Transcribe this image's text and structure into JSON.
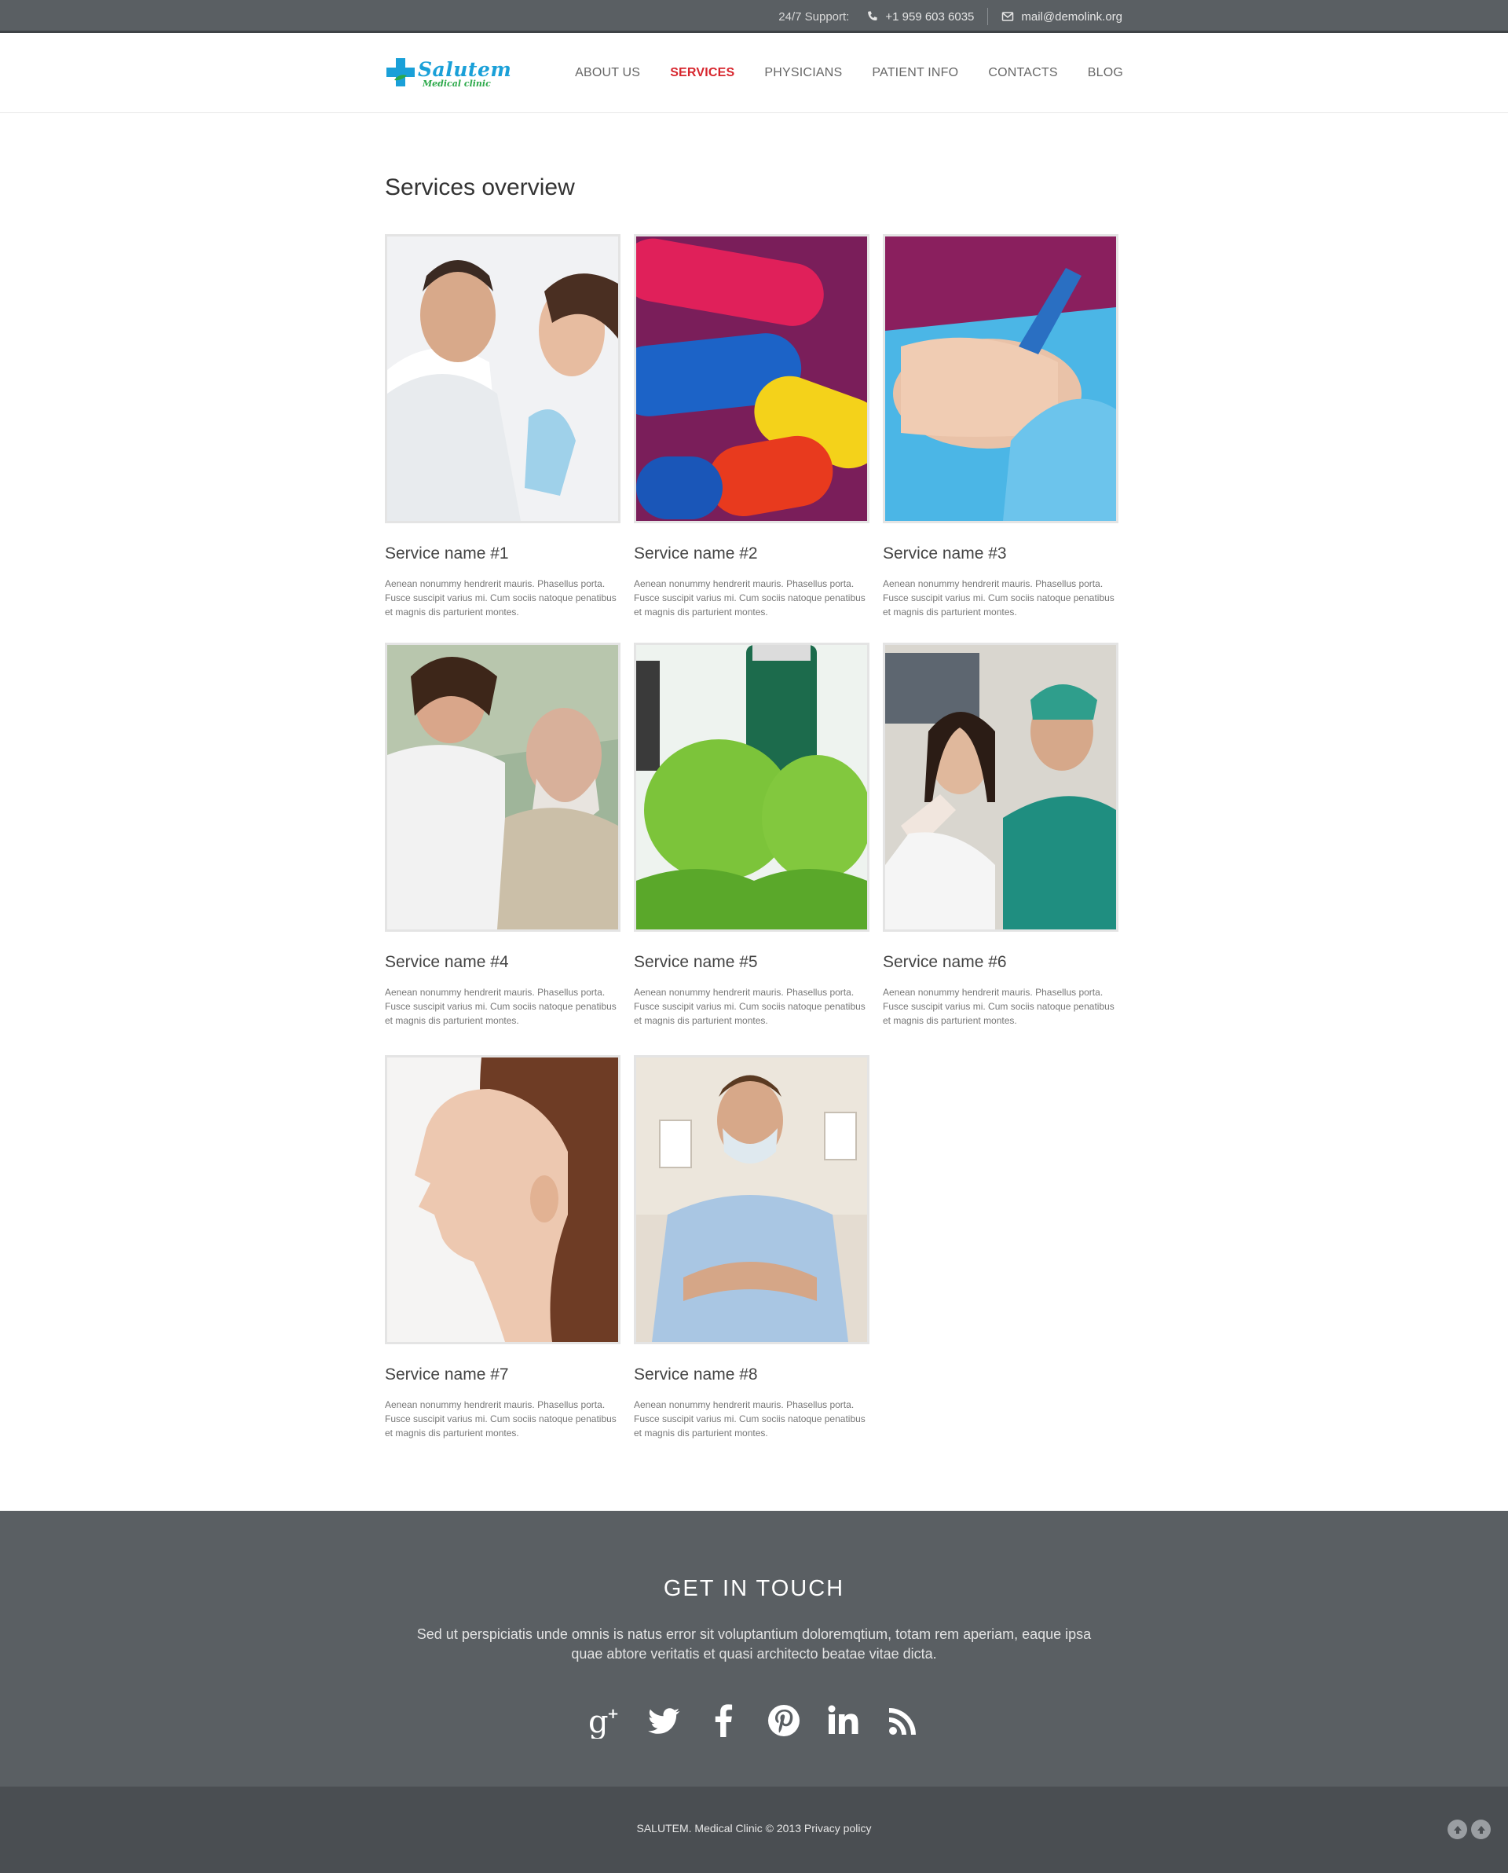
{
  "topbar": {
    "support_label": "24/7 Support:",
    "phone": "+1 959 603 6035",
    "email": "mail@demolink.org",
    "phone_icon": "phone-icon",
    "email_icon": "envelope-icon"
  },
  "logo": {
    "name": "Salutem",
    "tagline": "Medical clinic"
  },
  "nav": {
    "items": [
      {
        "label": "ABOUT US"
      },
      {
        "label": "SERVICES",
        "active": true
      },
      {
        "label": "PHYSICIANS"
      },
      {
        "label": "PATIENT INFO"
      },
      {
        "label": "CONTACTS"
      },
      {
        "label": "BLOG"
      }
    ]
  },
  "main": {
    "title": "Services overview",
    "services": [
      {
        "name": "Service name #1",
        "text": "Aenean nonummy hendrerit mauris. Phasellus porta. Fusce suscipit varius mi. Cum sociis natoque penatibus et magnis dis parturient montes."
      },
      {
        "name": "Service name #2",
        "text": "Aenean nonummy hendrerit mauris. Phasellus porta. Fusce suscipit varius mi. Cum sociis natoque penatibus et magnis dis parturient montes."
      },
      {
        "name": "Service name #3",
        "text": "Aenean nonummy hendrerit mauris. Phasellus porta. Fusce suscipit varius mi. Cum sociis natoque penatibus et magnis dis parturient montes."
      },
      {
        "name": "Service name #4",
        "text": "Aenean nonummy hendrerit mauris. Phasellus porta. Fusce suscipit varius mi. Cum sociis natoque penatibus et magnis dis parturient montes."
      },
      {
        "name": "Service name #5",
        "text": "Aenean nonummy hendrerit mauris. Phasellus porta. Fusce suscipit varius mi. Cum sociis natoque penatibus et magnis dis parturient montes."
      },
      {
        "name": "Service name #6",
        "text": "Aenean nonummy hendrerit mauris. Phasellus porta. Fusce suscipit varius mi. Cum sociis natoque penatibus et magnis dis parturient montes."
      },
      {
        "name": "Service name #7",
        "text": "Aenean nonummy hendrerit mauris. Phasellus porta. Fusce suscipit varius mi. Cum sociis natoque penatibus et magnis dis parturient montes."
      },
      {
        "name": "Service name #8",
        "text": "Aenean nonummy hendrerit mauris. Phasellus porta. Fusce suscipit varius mi. Cum sociis natoque penatibus et magnis dis parturient montes."
      }
    ]
  },
  "footer": {
    "title": "GET IN TOUCH",
    "text": "Sed ut perspiciatis unde omnis is natus error sit voluptantium doloremqtium, totam rem aperiam, eaque ipsa quae abtore veritatis et quasi architecto beatae vitae dicta.",
    "socials": [
      "google-plus-icon",
      "twitter-icon",
      "facebook-icon",
      "pinterest-icon",
      "linkedin-icon",
      "rss-icon"
    ],
    "copyright": "SALUTEM. Medical Clinic © 2013 Privacy policy"
  },
  "colors": {
    "accent": "#d7262e",
    "topbar_bg": "#5a5f63",
    "footer_bg": "#5a5f63",
    "bottombar_bg": "#4a4e52",
    "logo_blue": "#1aa0d8",
    "logo_green": "#2ca94a"
  }
}
